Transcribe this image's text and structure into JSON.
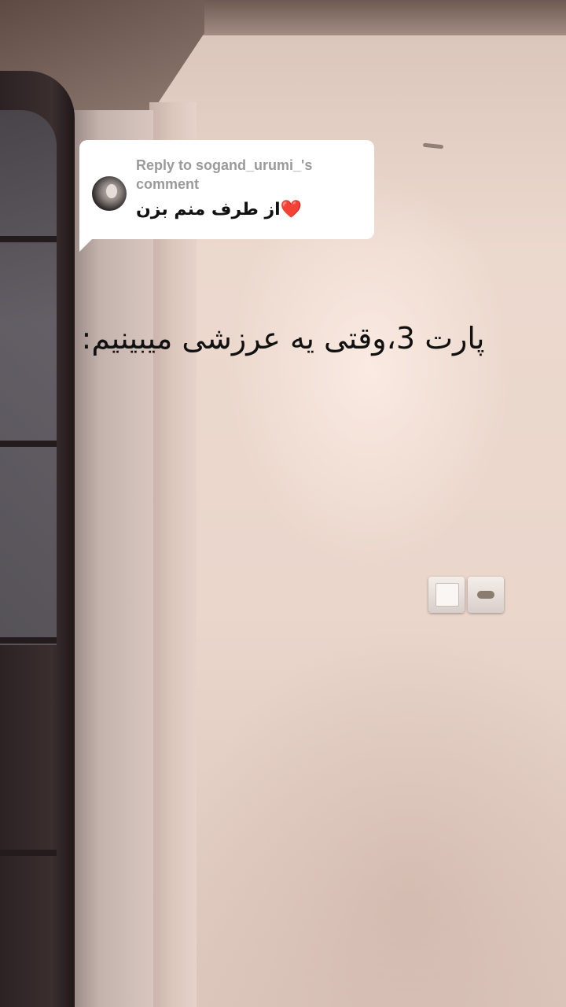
{
  "reply_card": {
    "header": "Reply to sogand_urumi_'s comment",
    "comment": "از طرف منم بزن❤️",
    "avatar_icon": "user-avatar-icon"
  },
  "caption": "پارت 3،وقتی یه عرزشی میبینیم:",
  "colors": {
    "card_background": "#ffffff",
    "header_text": "#9a9a9a",
    "comment_text": "#111111",
    "caption_text": "#111111"
  }
}
